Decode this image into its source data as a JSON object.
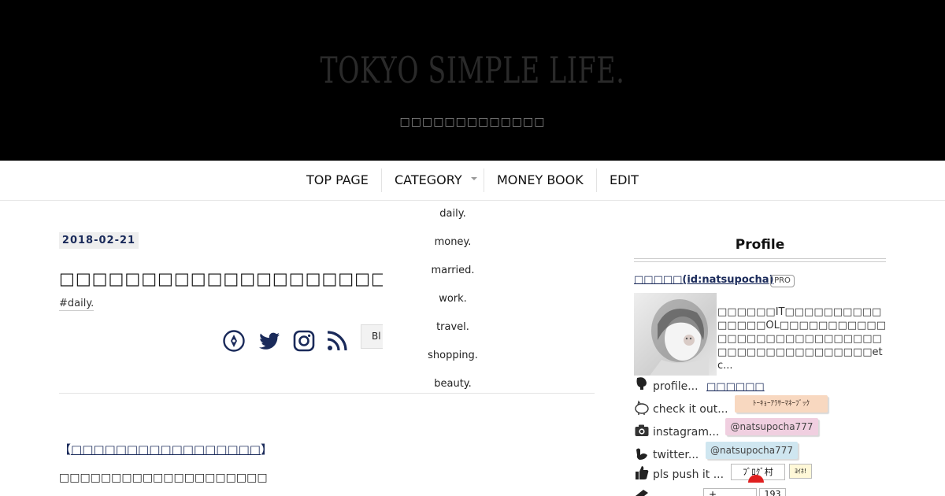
{
  "header": {
    "title": "TOKYO SIMPLE LIFE.",
    "description": "□□□□□□□□□□□□□"
  },
  "nav": {
    "items": [
      "TOP PAGE",
      "CATEGORY",
      "MONEY BOOK",
      "EDIT"
    ]
  },
  "dropdown": {
    "items": [
      "daily.",
      "money.",
      "married.",
      "work.",
      "travel.",
      "shopping.",
      "beauty."
    ]
  },
  "article": {
    "date": "2018-02-21",
    "title": "□□□□□□□□□□□□□□□□□□□□□□□□",
    "tag": "#daily.",
    "blog_chip": "Bl",
    "section_heading_open": "【",
    "section_heading_link": "□□□□□□□□□□□□□□□□□",
    "section_heading_close": "】",
    "body_line": "□□□□□□□□□□□□□□□□□□□□"
  },
  "share": {
    "icons": [
      "hatena-pen-icon",
      "twitter-icon",
      "instagram-icon",
      "rss-icon"
    ]
  },
  "sidebar": {
    "title": "Profile",
    "user": "□□□□□(id:natsupocha)",
    "pro_badge": "PRO",
    "bio": "□□□□□□IT□□□□□□□□□□□□□□□OL□□□□□□□□□□□□□□□□□□□□□□□□□□□□□□□□□□□□□□□□□□□□etc...",
    "rows": {
      "profile_label": "profile...",
      "profile_link": "□□□□□□",
      "checkit_label": "check it out...",
      "checkit_pill": "ﾄｰｷｮｰｱﾗｻｰﾏﾈｰﾌﾞｯｸ",
      "instagram_label": "instagram...",
      "instagram_pill": "@natsupocha777",
      "twitter_label": "twitter...",
      "twitter_pill": "@natsupocha777",
      "push_label": "pls push it ...",
      "push_banner": "ﾌﾞﾛｸﾞ村",
      "push_small": "ﾖｲﾈ!",
      "follow_count": "193"
    }
  },
  "colors": {
    "header_bg": "#000000",
    "accent_navy": "#1a2a5a",
    "pill_orange": "#f8d8c0",
    "pill_pink": "#f0cfe0",
    "pill_blue": "#cfe6f0"
  }
}
